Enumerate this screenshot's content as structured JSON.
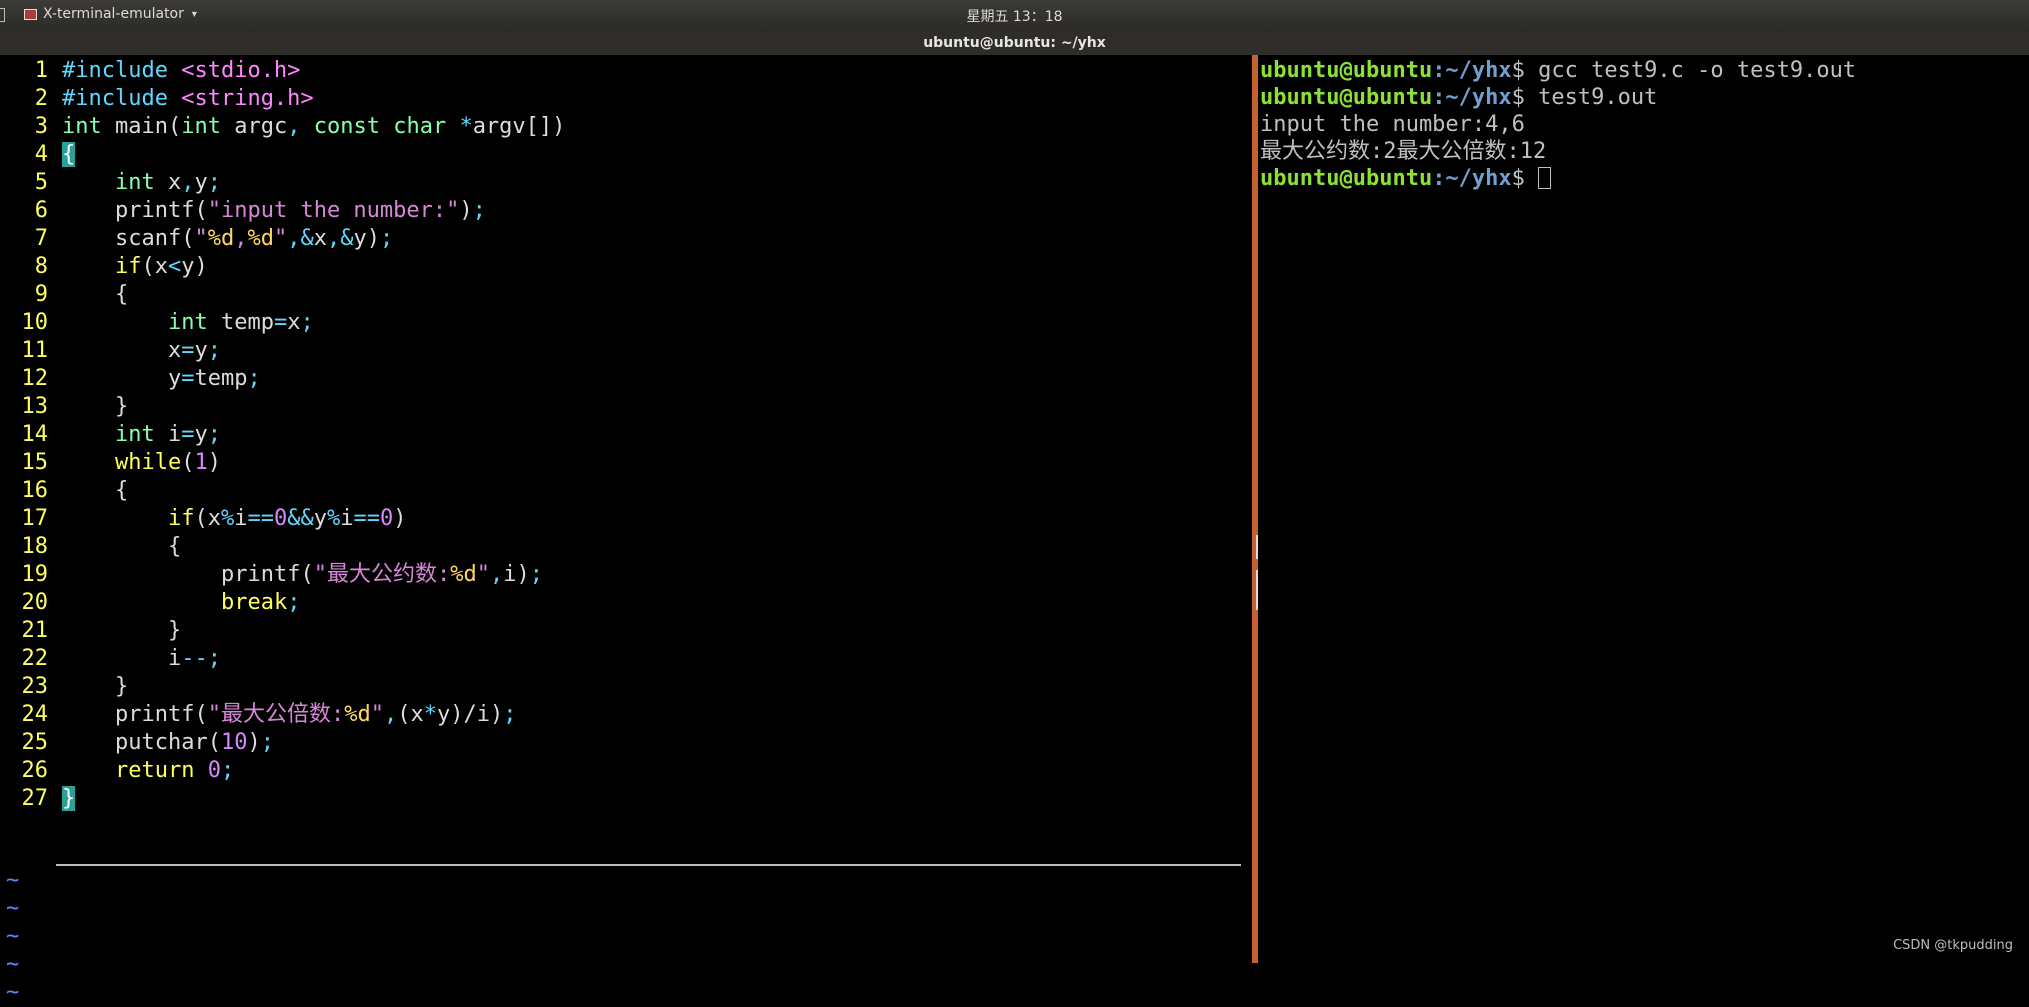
{
  "topbar": {
    "app_name": "X-terminal-emulator",
    "clock": "星期五 13：18"
  },
  "window": {
    "title": "ubuntu@ubuntu: ~/yhx"
  },
  "editor": {
    "lines": [
      "#include <stdio.h>",
      "#include <string.h>",
      "int main(int argc, const char *argv[])",
      "{",
      "    int x,y;",
      "    printf(\"input the number:\");",
      "    scanf(\"%d,%d\",&x,&y);",
      "    if(x<y)",
      "    {",
      "        int temp=x;",
      "        x=y;",
      "        y=temp;",
      "    }",
      "    int i=y;",
      "    while(1)",
      "    {",
      "        if(x%i==0&&y%i==0)",
      "        {",
      "            printf(\"最大公约数:%d\",i);",
      "            break;",
      "        }",
      "        i--;",
      "    }",
      "    printf(\"最大公倍数:%d\",(x*y)/i);",
      "    putchar(10);",
      "    return 0;",
      "}"
    ],
    "tilde": "~"
  },
  "terminal": {
    "prompt_user": "ubuntu@ubuntu",
    "prompt_path": ":~/yhx",
    "prompt_sign": "$ ",
    "lines": [
      {
        "type": "cmd",
        "text": "gcc test9.c -o test9.out"
      },
      {
        "type": "cmd",
        "text": "test9.out"
      },
      {
        "type": "out",
        "text": "input the number:4,6"
      },
      {
        "type": "out",
        "text": "最大公约数:2最大公倍数:12"
      },
      {
        "type": "cmd",
        "text": ""
      }
    ]
  },
  "watermark": "CSDN @tkpudding",
  "colors": {
    "divider": "#c5602f",
    "prompt_user": "#8ae234",
    "prompt_path": "#729fcf",
    "line_number": "#ffff5f",
    "cursor": "#2aa198"
  }
}
